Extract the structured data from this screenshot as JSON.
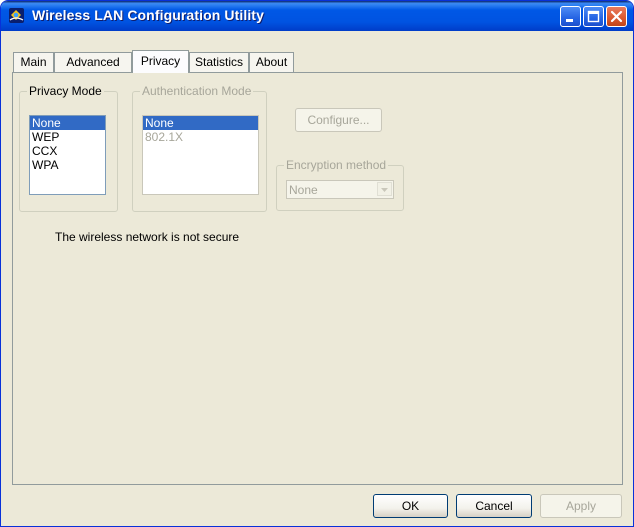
{
  "window": {
    "title": "Wireless LAN Configuration Utility",
    "icon": "wireless-network-icon",
    "controls": [
      "minimize-icon",
      "maximize-icon",
      "close-icon"
    ]
  },
  "tabs": [
    {
      "label": "Main",
      "active": false
    },
    {
      "label": "Advanced",
      "active": false
    },
    {
      "label": "Privacy",
      "active": true
    },
    {
      "label": "Statistics",
      "active": false
    },
    {
      "label": "About",
      "active": false
    }
  ],
  "privacy_mode": {
    "label": "Privacy Mode",
    "options": [
      "None",
      "WEP",
      "CCX",
      "WPA"
    ],
    "selected": "None"
  },
  "auth_mode": {
    "label": "Authentication Mode",
    "enabled": false,
    "options": [
      "None",
      "802.1X"
    ],
    "selected": "None"
  },
  "configure_button": {
    "label": "Configure...",
    "enabled": false
  },
  "encryption": {
    "label": "Encryption method",
    "value": "None",
    "enabled": false
  },
  "status_text": "The wireless network is not secure",
  "buttons": {
    "ok": "OK",
    "cancel": "Cancel",
    "apply": "Apply",
    "apply_enabled": false
  },
  "colors": {
    "titlebar": "#0058e6",
    "selection": "#316ac5",
    "panel": "#ece9d8",
    "disabled_text": "#a7a69a"
  }
}
